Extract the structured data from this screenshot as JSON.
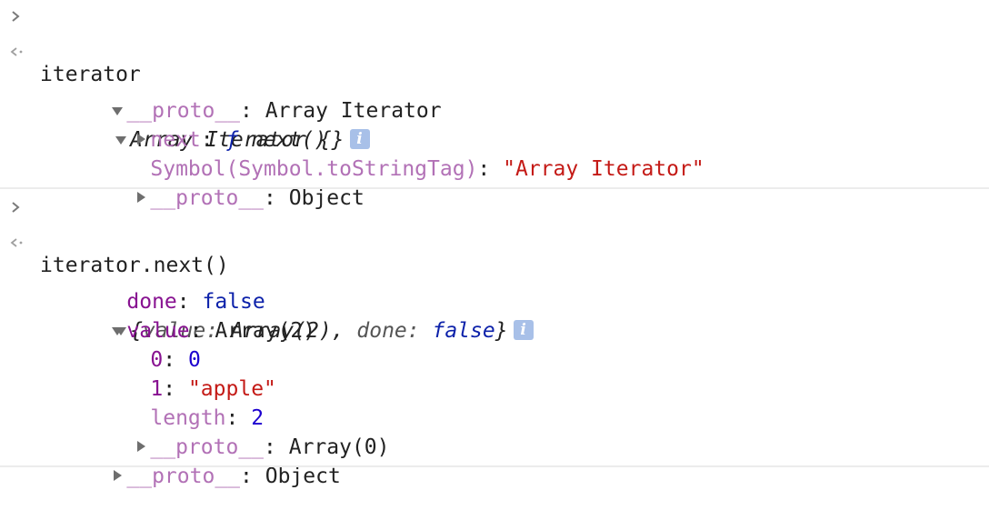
{
  "glyphs": {
    "prompt": "›",
    "result": "‹·",
    "info": "i"
  },
  "entry1": {
    "input": "iterator",
    "summary": "Array Iterator {}",
    "proto_key": "__proto__",
    "proto_value": "Array Iterator",
    "next_key": "next",
    "next_f": "ƒ",
    "next_value": "next()",
    "sym_key": "Symbol(Symbol.toStringTag)",
    "sym_value": "\"Array Iterator\"",
    "proto2_key": "__proto__",
    "proto2_value": "Object"
  },
  "entry2": {
    "input": "iterator.next()",
    "summary_open": "{",
    "summary_value_key": "value",
    "summary_value": "Array(2)",
    "summary_done_key": "done",
    "summary_done": "false",
    "summary_close": "}",
    "done_key": "done",
    "done_value": "false",
    "value_key": "value",
    "value_value": "Array(2)",
    "idx0_key": "0",
    "idx0_value": "0",
    "idx1_key": "1",
    "idx1_value": "\"apple\"",
    "length_key": "length",
    "length_value": "2",
    "arr_proto_key": "__proto__",
    "arr_proto_value": "Array(0)",
    "obj_proto_key": "__proto__",
    "obj_proto_value": "Object"
  },
  "colors": {
    "string": "#c41a16",
    "number": "#1c00cf",
    "boolean": "#0d22aa",
    "own_key": "#881391",
    "proto_key": "#b271b6"
  }
}
